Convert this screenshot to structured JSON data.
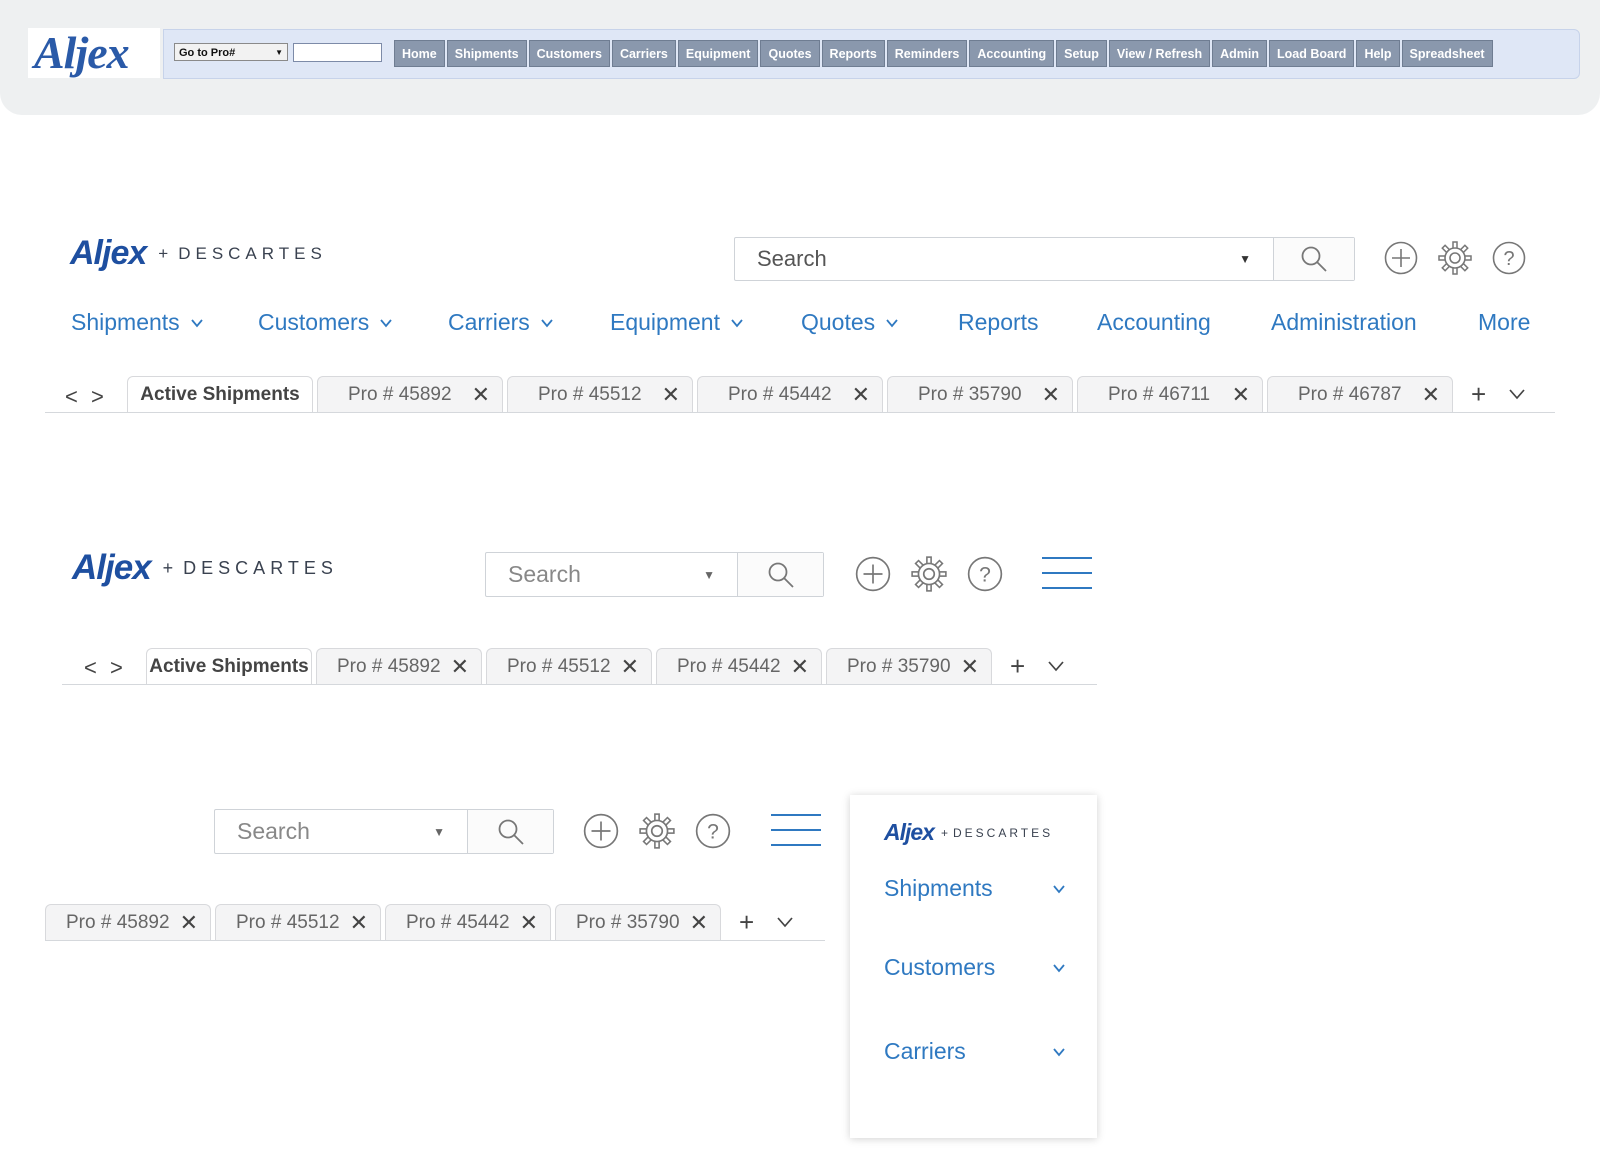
{
  "legacy": {
    "logo": "Aljex",
    "goto_select": "Go to Pro#",
    "goto_input": "",
    "nav": [
      "Home",
      "Shipments",
      "Customers",
      "Carriers",
      "Equipment",
      "Quotes",
      "Reports",
      "Reminders",
      "Accounting",
      "Setup",
      "View / Refresh",
      "Admin",
      "Load Board",
      "Help",
      "Spreadsheet"
    ]
  },
  "brand": {
    "logo": "Aljex",
    "plus": "+",
    "partner": "DESCARTES"
  },
  "search": {
    "placeholder": "Search"
  },
  "desktop": {
    "nav": [
      {
        "label": "Shipments",
        "has_dropdown": true
      },
      {
        "label": "Customers",
        "has_dropdown": true
      },
      {
        "label": "Carriers",
        "has_dropdown": true
      },
      {
        "label": "Equipment",
        "has_dropdown": true
      },
      {
        "label": "Quotes",
        "has_dropdown": true
      },
      {
        "label": "Reports",
        "has_dropdown": false
      },
      {
        "label": "Accounting",
        "has_dropdown": false
      },
      {
        "label": "Administration",
        "has_dropdown": false
      },
      {
        "label": "More",
        "has_dropdown": false
      }
    ],
    "active_tab": "Active Shipments",
    "tabs": [
      "Pro # 45892",
      "Pro # 45512",
      "Pro # 45442",
      "Pro # 35790",
      "Pro # 46711",
      "Pro # 46787"
    ]
  },
  "tablet": {
    "active_tab": "Active Shipments",
    "tabs": [
      "Pro # 45892",
      "Pro # 45512",
      "Pro # 45442",
      "Pro # 35790"
    ]
  },
  "mobile": {
    "tabs": [
      "Pro # 45892",
      "Pro # 45512",
      "Pro # 45442",
      "Pro # 35790"
    ],
    "menu": [
      "Shipments",
      "Customers",
      "Carriers"
    ]
  },
  "colors": {
    "accent": "#2f79c1",
    "brand": "#1e4fa0",
    "legacy_button": "#8a98ad",
    "legacy_bar": "#dfe7f6"
  }
}
